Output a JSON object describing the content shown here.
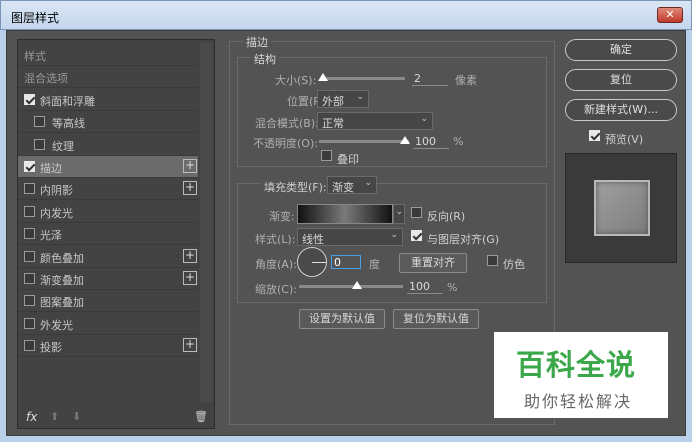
{
  "window": {
    "title": "图层样式",
    "close_glyph": "✕"
  },
  "sidebar": {
    "items": [
      {
        "label": "样式",
        "has_checkbox": false,
        "checked": false,
        "has_plus": false,
        "selected": false,
        "muted": true
      },
      {
        "label": "混合选项",
        "has_checkbox": false,
        "checked": false,
        "has_plus": false,
        "selected": false,
        "muted": true
      },
      {
        "label": "斜面和浮雕",
        "has_checkbox": true,
        "checked": true,
        "has_plus": false,
        "selected": false,
        "muted": false
      },
      {
        "label": "等高线",
        "has_checkbox": true,
        "checked": false,
        "has_plus": false,
        "selected": false,
        "muted": false,
        "indent": true
      },
      {
        "label": "纹理",
        "has_checkbox": true,
        "checked": false,
        "has_plus": false,
        "selected": false,
        "muted": false,
        "indent": true
      },
      {
        "label": "描边",
        "has_checkbox": true,
        "checked": true,
        "has_plus": true,
        "selected": true,
        "muted": false
      },
      {
        "label": "内阴影",
        "has_checkbox": true,
        "checked": false,
        "has_plus": true,
        "selected": false,
        "muted": false
      },
      {
        "label": "内发光",
        "has_checkbox": true,
        "checked": false,
        "has_plus": false,
        "selected": false,
        "muted": false
      },
      {
        "label": "光泽",
        "has_checkbox": true,
        "checked": false,
        "has_plus": false,
        "selected": false,
        "muted": false
      },
      {
        "label": "颜色叠加",
        "has_checkbox": true,
        "checked": false,
        "has_plus": true,
        "selected": false,
        "muted": false
      },
      {
        "label": "渐变叠加",
        "has_checkbox": true,
        "checked": false,
        "has_plus": true,
        "selected": false,
        "muted": false
      },
      {
        "label": "图案叠加",
        "has_checkbox": true,
        "checked": false,
        "has_plus": false,
        "selected": false,
        "muted": false
      },
      {
        "label": "外发光",
        "has_checkbox": true,
        "checked": false,
        "has_plus": false,
        "selected": false,
        "muted": false
      },
      {
        "label": "投影",
        "has_checkbox": true,
        "checked": false,
        "has_plus": true,
        "selected": false,
        "muted": false
      }
    ],
    "plus_glyph": "+",
    "fx_label": "fx",
    "up_glyph": "⬆",
    "down_glyph": "⬇",
    "trash_glyph": "🗑"
  },
  "stroke": {
    "group_title": "描边",
    "structure_title": "结构",
    "size_label": "大小(S):",
    "size_value": "2",
    "size_unit": "像素",
    "position_label": "位置(P):",
    "position_value": "外部",
    "blend_label": "混合模式(B):",
    "blend_value": "正常",
    "opacity_label": "不透明度(O):",
    "opacity_value": "100",
    "opacity_unit": "%",
    "overprint_label": "叠印",
    "fill_type_label": "填充类型(F):",
    "fill_type_value": "渐变",
    "gradient_label": "渐变:",
    "reverse_label": "反向(R)",
    "style_label": "样式(L):",
    "style_value": "线性",
    "align_label": "与图层对齐(G)",
    "angle_label": "角度(A):",
    "angle_value": "0",
    "angle_unit": "度",
    "reset_align_label": "重置对齐",
    "dither_label": "仿色",
    "scale_label": "缩放(C):",
    "scale_value": "100",
    "scale_unit": "%",
    "set_default_label": "设置为默认值",
    "reset_default_label": "复位为默认值"
  },
  "actions": {
    "ok_label": "确定",
    "reset_label": "复位",
    "new_style_label": "新建样式(W)...",
    "preview_label": "预览(V)"
  },
  "watermark": {
    "title": "百科全说",
    "subtitle": "助你轻松解决"
  },
  "colors": {
    "panel": "#535353",
    "list": "#434343",
    "selected": "#6b6b6b",
    "watermark_green": "#3aa84a"
  }
}
